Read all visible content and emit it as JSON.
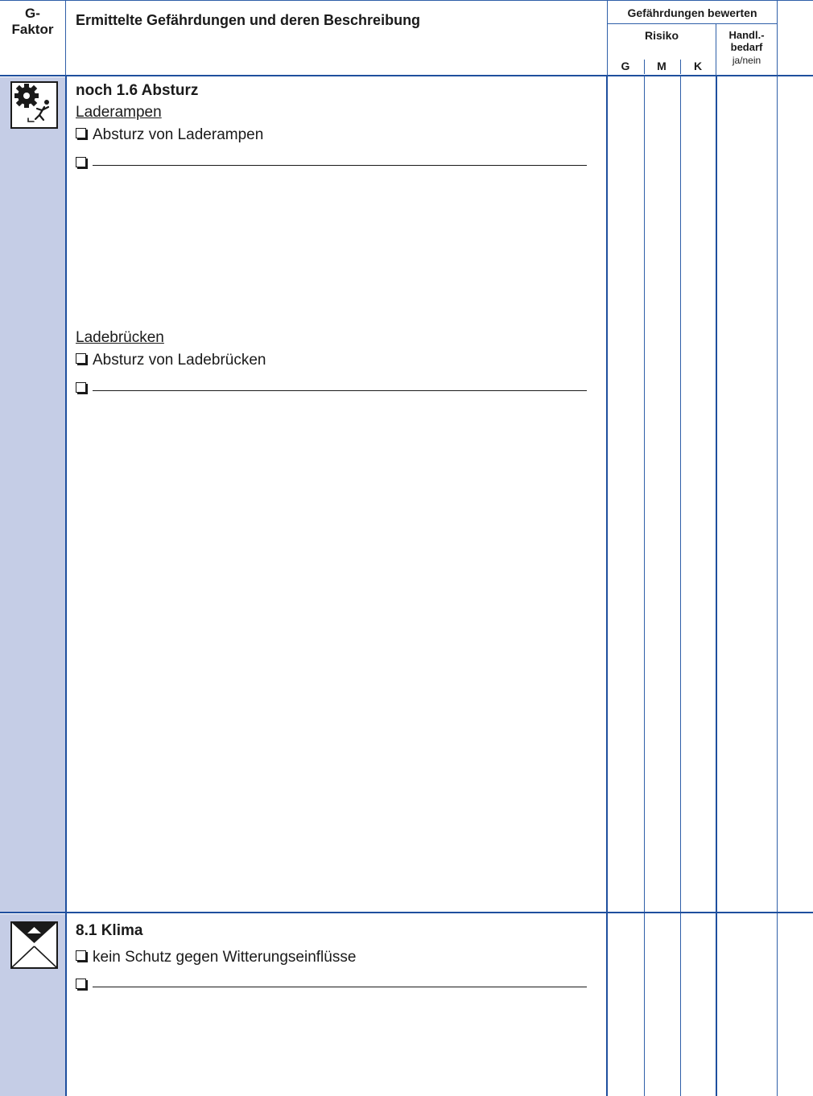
{
  "header": {
    "gfaktor_line1": "G-",
    "gfaktor_line2": "Faktor",
    "title": "Ermittelte Gefährdungen und deren Beschreibung",
    "bewerten": "Gefährdungen bewerten",
    "risiko": "Risiko",
    "handl_line1": "Handl.-",
    "handl_line2": "bedarf",
    "handl_line3": "ja/nein",
    "col_g": "G",
    "col_m": "M",
    "col_k": "K"
  },
  "sections": [
    {
      "icon": "gear-fall-icon",
      "title": "noch 1.6  Absturz",
      "groups": [
        {
          "subheading": "Laderampen",
          "items": [
            "Absturz von Laderampen",
            ""
          ]
        },
        {
          "subheading": "Ladebrücken",
          "items": [
            "Absturz von Ladebrücken",
            ""
          ]
        }
      ]
    },
    {
      "icon": "climate-icon",
      "title": "8.1  Klima",
      "groups": [
        {
          "subheading": "",
          "items": [
            "kein Schutz gegen Witterungseinflüsse",
            ""
          ]
        }
      ]
    }
  ]
}
